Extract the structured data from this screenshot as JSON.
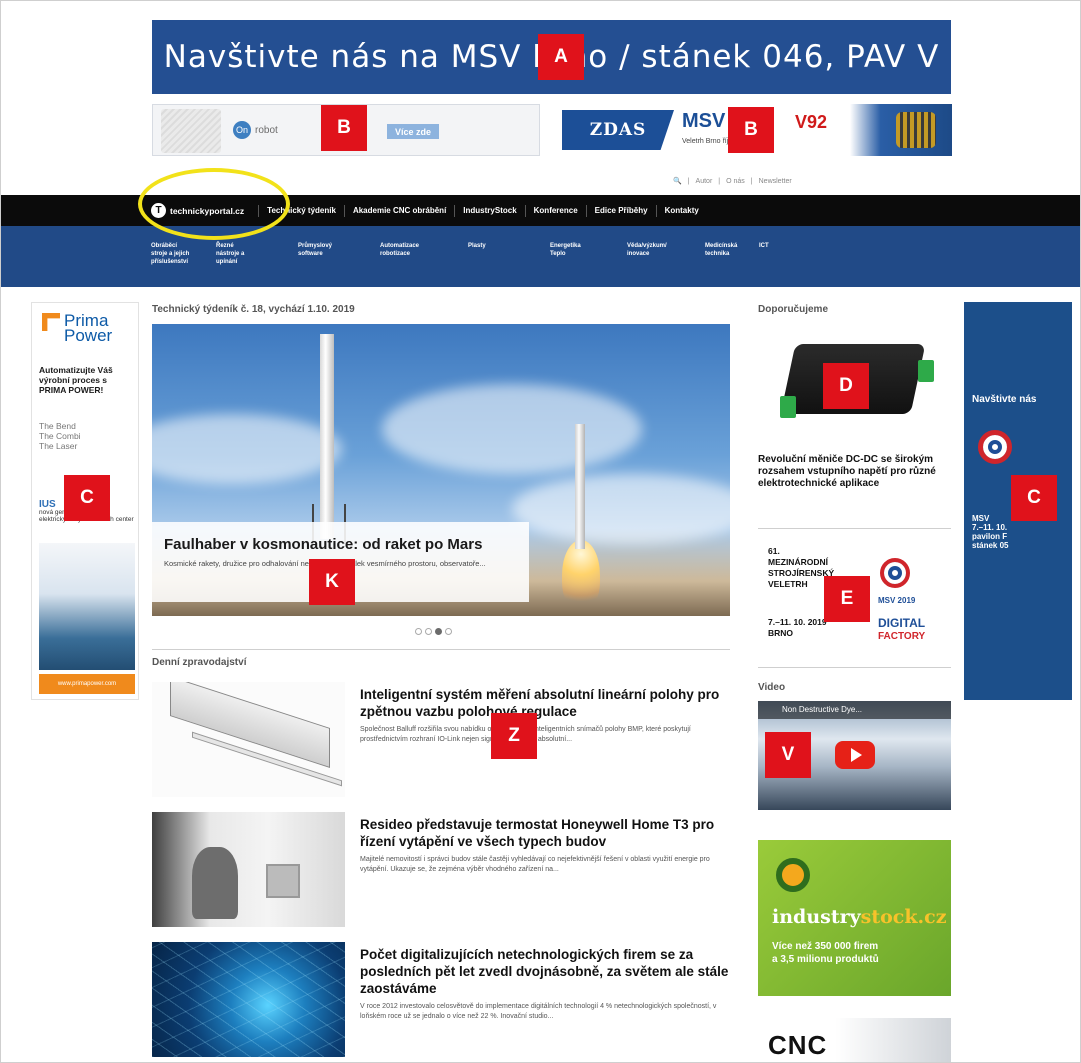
{
  "labels": {
    "a": "A",
    "b": "B",
    "c": "C",
    "d": "D",
    "e": "E",
    "k": "K",
    "z": "Z",
    "v": "V"
  },
  "banner_top": {
    "text": "Navštivte nás na MSV Brno / stánek 046, PAV V"
  },
  "banner_left": {
    "brand": "robot",
    "cta": "Více zde"
  },
  "banner_right": {
    "logo": "ZDAS",
    "msv": "MSV",
    "stand": "V92",
    "sub": "Veletrh Brno  října 2019"
  },
  "utility": {
    "items": [
      "Autor",
      "O nás",
      "Newsletter"
    ]
  },
  "nav": {
    "brand": "technickyportal.cz",
    "items": [
      "Technický týdeník",
      "Akademie CNC obrábění",
      "IndustryStock",
      "Konference",
      "Edice Příběhy",
      "Kontakty"
    ]
  },
  "subnav": {
    "items": [
      "Obráběcí\nstroje a jejich\npříslušenství",
      "Řezné\nnástroje a\nupínání",
      "Průmyslový\nsoftware",
      "Automatizace\nrobotizace",
      "Plasty",
      "Energetika\nTeplo",
      "Věda/výzkum/\ninovace",
      "Medicínská\ntechnika",
      "ICT"
    ]
  },
  "ad_left": {
    "brand": "Prima\nPower",
    "slogan": "Automatizujte Váš výrobní proces s PRIMA POWER!",
    "list": [
      "The Bend",
      "The Combi",
      "The Laser"
    ],
    "series_name": "IUS",
    "series_desc": "nová generace servo-elektrických vysekávacích center",
    "footer": "www.primapower.com"
  },
  "ad_right": {
    "title": "Navštivte nás",
    "info": "MSV\n7.–11. 10.\npavilon F\nstánek 05"
  },
  "main": {
    "issue_title": "Technický týdeník č. 18, vychází 1.10. 2019",
    "hero": {
      "title": "Faulhaber v kosmonautice: od raket po Mars",
      "desc": "Kosmické rakety, družice pro odhalování nekonečných dálek vesmírného prostoru, observatoře..."
    },
    "daily_title": "Denní zpravodajství",
    "news": [
      {
        "title": "Inteligentní systém měření absolutní lineární polohy pro zpětnou vazbu polohové regulace",
        "desc": "Společnost Balluff rozšiřila svou nabídku o řadu nových inteligentních snímačů polohy BMP, které poskytují prostřednictvím rozhraní IO-Link nejen signál s hodnotou absolutní..."
      },
      {
        "title": "Resideo představuje termostat Honeywell Home T3 pro řízení vytápění ve všech typech budov",
        "desc": "Majitelé nemovitostí i správci budov stále častěji vyhledávají co nejefektivnější řešení v oblasti využití energie pro vytápění. Ukazuje se, že zejména výběr vhodného zařízení na..."
      },
      {
        "title": "Počet digitalizujících netechnologických firem se za posledních pět let zvedl dvojnásobně, za světem ale stále zaostáváme",
        "desc": "V roce 2012 investovalo celosvětově do implementace digitálních technologií 4 % netechnologických společností, v loňském roce už se jednalo o více než 22 %. Inovační studio..."
      }
    ]
  },
  "sidebar": {
    "recommend_title": "Doporučujeme",
    "recommend_text": "Revoluční měniče DC-DC se širokým rozsahem vstupního napětí pro různé elektrotechnické aplikace",
    "ad_e": {
      "lines": "61.\nMEZINÁRODNÍ\nSTROJÍRENSKÝ\nVELETRH",
      "date": "7.–11. 10. 2019\nBRNO",
      "msv": "MSV 2019",
      "digital": "DIGITAL",
      "factory": "FACTORY"
    },
    "video_title": "Video",
    "video_bar": "Non Destructive Dye...",
    "industry": {
      "brand_a": "industry",
      "brand_b": "stock.cz",
      "claim": "Více než 350 000 firem\na 3,5 milionu produktů"
    },
    "cnc": "CNC"
  }
}
